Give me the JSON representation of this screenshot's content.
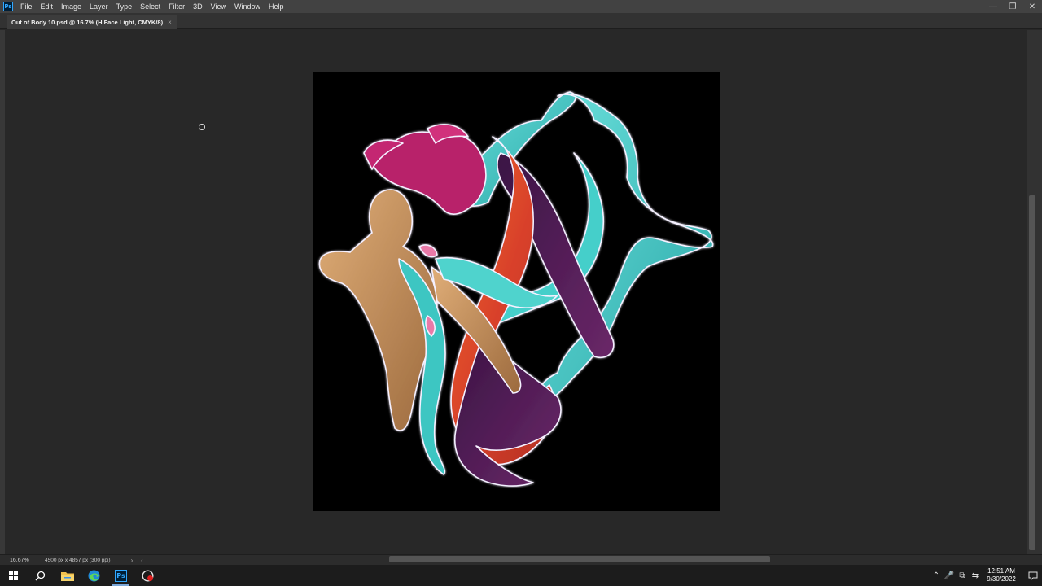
{
  "app": {
    "logo_label": "Ps",
    "menu": [
      "File",
      "Edit",
      "Image",
      "Layer",
      "Type",
      "Select",
      "Filter",
      "3D",
      "View",
      "Window",
      "Help"
    ]
  },
  "window_controls": {
    "minimize": "—",
    "restore": "❐",
    "close": "✕"
  },
  "document_tab": {
    "title": "Out of Body 10.psd @ 16.7% (H Face Light, CMYK/8)",
    "close": "×"
  },
  "status": {
    "zoom": "16.67%",
    "doc_info": "4500 px x 4857 px (300 ppi)",
    "arrow": "›",
    "scroll_left": "‹"
  },
  "taskbar": {
    "apps": [
      "start",
      "search",
      "file-explorer",
      "edge",
      "photoshop",
      "recorder"
    ],
    "ps_label": "Ps",
    "time": "12:51 AM",
    "date": "9/30/2022",
    "tray_icons": [
      "⌃",
      "🎤",
      "⧉",
      "⇆"
    ]
  },
  "colors": {
    "artwork_cyan": "#3ec6c2",
    "artwork_magenta": "#c0246e",
    "artwork_orange": "#e5532a",
    "artwork_purple": "#5a1f5c",
    "artwork_skin": "#c08a55"
  }
}
